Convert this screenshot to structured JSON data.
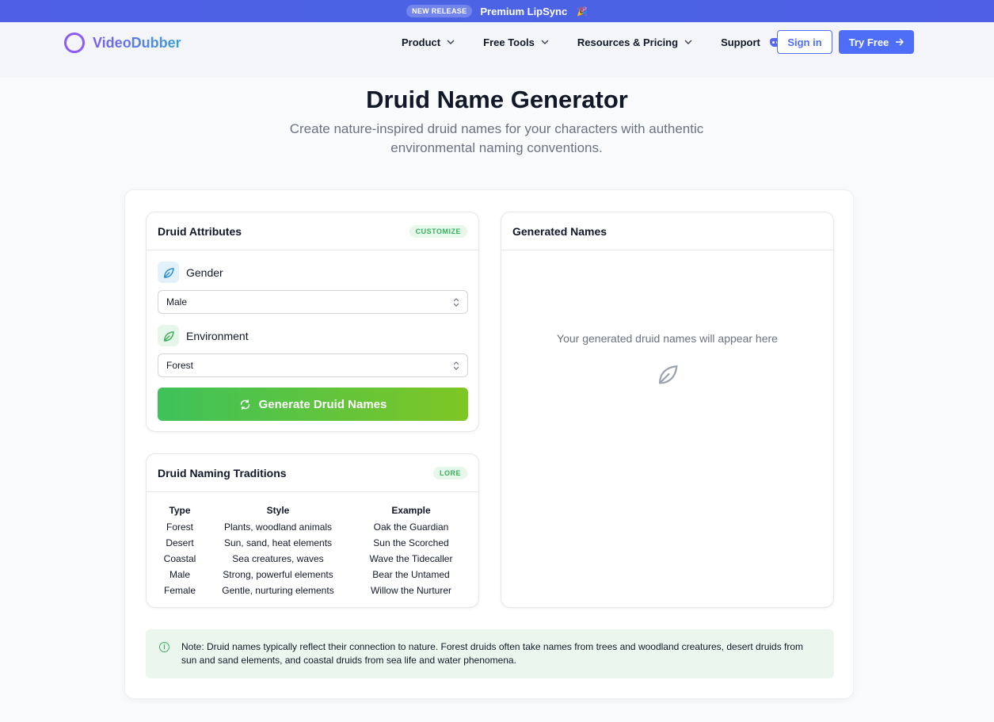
{
  "banner": {
    "badge": "NEW RELEASE",
    "text": "Premium LipSync",
    "emoji": "🎉"
  },
  "header": {
    "logo_text": "VideoDubber",
    "nav": [
      {
        "label": "Product"
      },
      {
        "label": "Free Tools"
      },
      {
        "label": "Resources & Pricing"
      },
      {
        "label": "Support"
      }
    ],
    "signin_label": "Sign in",
    "tryfree_label": "Try Free",
    "icons": {
      "chevron": "chevron-down-icon",
      "discord": "discord-icon",
      "arrow": "arrow-right-icon"
    }
  },
  "hero": {
    "title": "Druid Name Generator",
    "subtitle": "Create nature-inspired druid names for your characters with authentic environmental naming conventions."
  },
  "attributes": {
    "title": "Druid Attributes",
    "badge": "CUSTOMIZE",
    "gender_label": "Gender",
    "gender_value": "Male",
    "environment_label": "Environment",
    "environment_value": "Forest",
    "generate_label": "Generate Druid Names"
  },
  "traditions": {
    "title": "Druid Naming Traditions",
    "badge": "LORE",
    "headers": [
      "Type",
      "Style",
      "Example"
    ],
    "rows": [
      [
        "Forest",
        "Plants, woodland animals",
        "Oak the Guardian"
      ],
      [
        "Desert",
        "Sun, sand, heat elements",
        "Sun the Scorched"
      ],
      [
        "Coastal",
        "Sea creatures, waves",
        "Wave the Tidecaller"
      ],
      [
        "Male",
        "Strong, powerful elements",
        "Bear the Untamed"
      ],
      [
        "Female",
        "Gentle, nurturing elements",
        "Willow the Nurturer"
      ]
    ]
  },
  "generated": {
    "title": "Generated Names",
    "placeholder": "Your generated druid names will appear here"
  },
  "note": {
    "text": "Note: Druid names typically reflect their connection to nature. Forest druids often take names from trees and woodland creatures, desert druids from sun and sand elements, and coastal druids from sea life and water phenomena."
  },
  "colors": {
    "brand_blue": "#4f6ef7",
    "green_start": "#3ec25a",
    "green_end": "#7ec624",
    "logo_purple": "#8b5cf6"
  }
}
